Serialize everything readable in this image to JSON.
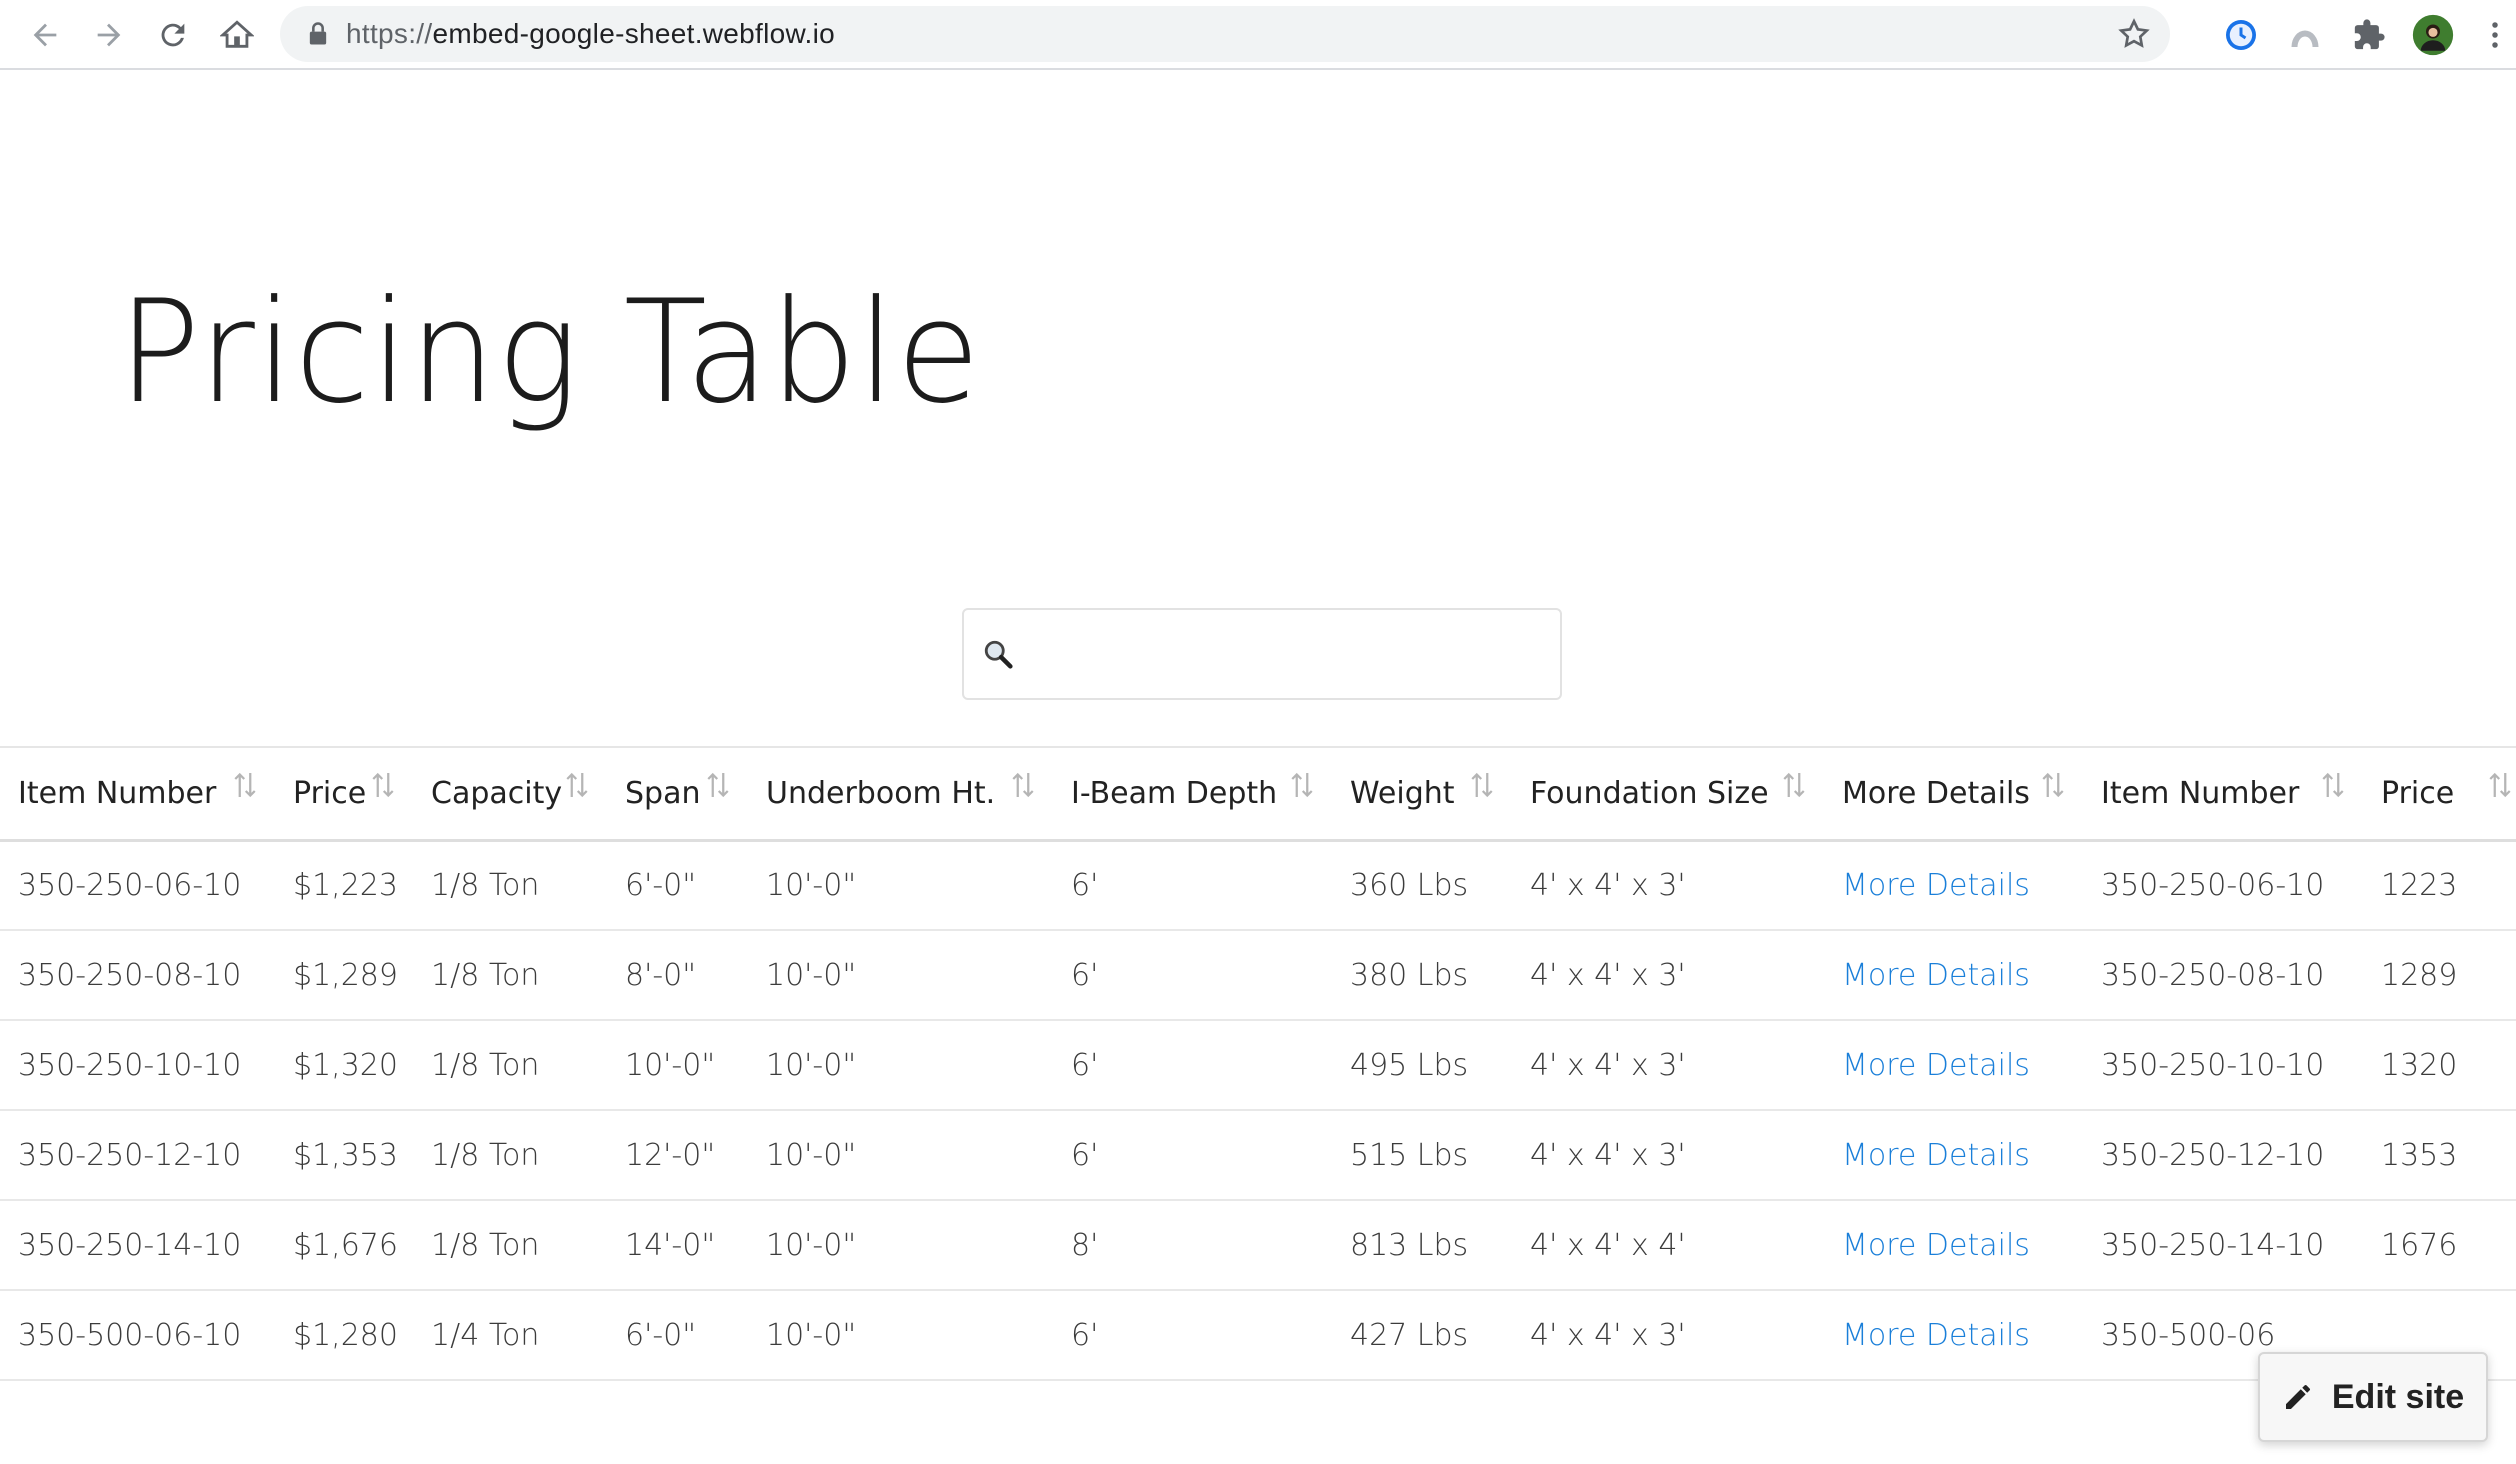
{
  "browser": {
    "url_scheme": "https://",
    "url_host": "embed-google-sheet.webflow.io"
  },
  "page": {
    "title": "Pricing Table",
    "search": {
      "placeholder": "",
      "value": ""
    }
  },
  "table": {
    "columns": [
      "Item Number",
      "Price",
      "Capacity",
      "Span",
      "Underboom Ht.",
      "I-Beam Depth",
      "Weight",
      "Foundation Size",
      "More Details",
      "Item Number",
      "Price"
    ],
    "rows": [
      [
        "350-250-06-10",
        "$1,223",
        "1/8 Ton",
        "6'-0\"",
        "10'-0\"",
        "6'",
        "360 Lbs",
        "4' x 4' x 3'",
        "More Details",
        "350-250-06-10",
        "1223"
      ],
      [
        "350-250-08-10",
        "$1,289",
        "1/8 Ton",
        "8'-0\"",
        "10'-0\"",
        "6'",
        "380 Lbs",
        "4' x 4' x 3'",
        "More Details",
        "350-250-08-10",
        "1289"
      ],
      [
        "350-250-10-10",
        "$1,320",
        "1/8 Ton",
        "10'-0\"",
        "10'-0\"",
        "6'",
        "495 Lbs",
        "4' x 4' x 3'",
        "More Details",
        "350-250-10-10",
        "1320"
      ],
      [
        "350-250-12-10",
        "$1,353",
        "1/8 Ton",
        "12'-0\"",
        "10'-0\"",
        "6'",
        "515 Lbs",
        "4' x 4' x 3'",
        "More Details",
        "350-250-12-10",
        "1353"
      ],
      [
        "350-250-14-10",
        "$1,676",
        "1/8 Ton",
        "14'-0\"",
        "10'-0\"",
        "8'",
        "813 Lbs",
        "4' x 4' x 4'",
        "More Details",
        "350-250-14-10",
        "1676"
      ],
      [
        "350-500-06-10",
        "$1,280",
        "1/4 Ton",
        "6'-0\"",
        "10'-0\"",
        "6'",
        "427 Lbs",
        "4' x 4' x 3'",
        "More Details",
        "350-500-06",
        ""
      ]
    ]
  },
  "edit_site": {
    "label": "Edit site"
  },
  "colors": {
    "link": "#1a7fd9",
    "title": "#1c1c1c"
  }
}
